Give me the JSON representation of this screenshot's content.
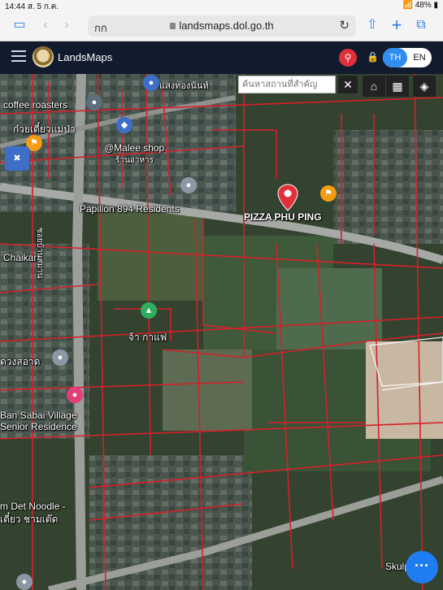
{
  "status_bar": {
    "time": "14:44",
    "date": "ส. 5 ก.ค.",
    "battery": "48%"
  },
  "browser": {
    "aa_label": "กก",
    "url": "landsmaps.dol.go.th"
  },
  "app": {
    "brand": "LandsMaps",
    "lang_th": "TH",
    "lang_en": "EN",
    "search_placeholder": "ค้นหาสถานที่สำคัญ"
  },
  "map": {
    "labels": [
      "coffee roasters",
      "ก๋วยเตี๋ยวแม่ป่า",
      "@Malee shop",
      "ร้านอาหาร",
      "Papillon 894 Residents",
      "PIZZA PHU PING",
      "Chaikam",
      "ซอยบ้านสมาน",
      "จ้า กาแฟ",
      "ดวงสอาด",
      "Ban Sabai Village",
      "Senior Residence",
      "m Det Noodle -",
      "เตี๋ยว ชามเต๊ด",
      "Skulphan's",
      "แสงทองนันท์"
    ]
  },
  "colors": {
    "parcel_line": "#d6202a",
    "app_bar": "#121a2e",
    "accent_blue": "#2f8cf0",
    "search_red": "#e0303a"
  }
}
